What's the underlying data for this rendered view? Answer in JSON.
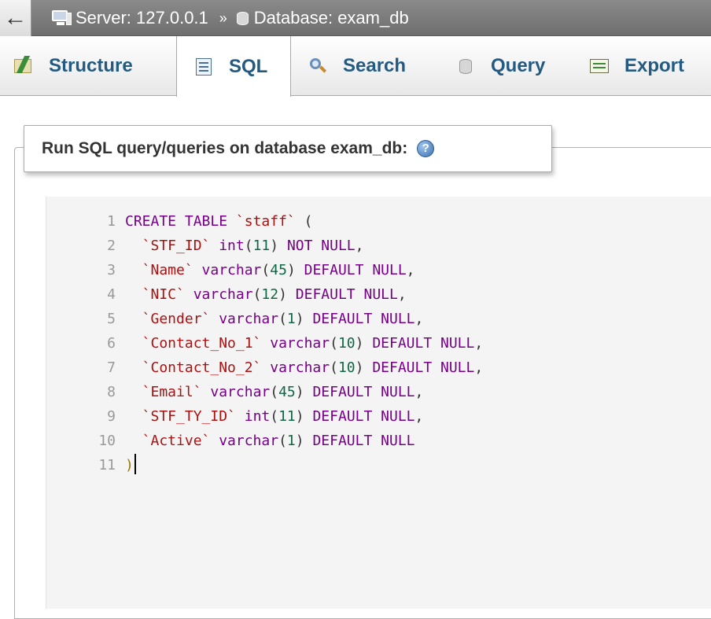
{
  "breadcrumb": {
    "back_label": "←",
    "server_label": "Server: 127.0.0.1",
    "separator": "»",
    "database_label": "Database: exam_db"
  },
  "tabs": [
    {
      "label": "Structure",
      "icon": "structure-icon",
      "active": false
    },
    {
      "label": "SQL",
      "icon": "sql-icon",
      "active": true
    },
    {
      "label": "Search",
      "icon": "search-icon",
      "active": false
    },
    {
      "label": "Query",
      "icon": "query-icon",
      "active": false
    },
    {
      "label": "Export",
      "icon": "export-icon",
      "active": false
    }
  ],
  "query_panel": {
    "legend": "Run SQL query/queries on database exam_db:",
    "help_icon": "help-icon"
  },
  "editor": {
    "line_numbers": [
      "1",
      "2",
      "3",
      "4",
      "5",
      "6",
      "7",
      "8",
      "9",
      "10",
      "11"
    ],
    "lines": [
      [
        {
          "t": "CREATE TABLE ",
          "c": "kw"
        },
        {
          "t": "`staff`",
          "c": "str"
        },
        {
          "t": " (",
          "c": "punc"
        }
      ],
      [
        {
          "t": "  `STF_ID`",
          "c": "str"
        },
        {
          "t": " int",
          "c": "kw"
        },
        {
          "t": "(",
          "c": "punc"
        },
        {
          "t": "11",
          "c": "num"
        },
        {
          "t": ") ",
          "c": "punc"
        },
        {
          "t": "NOT NULL",
          "c": "kw"
        },
        {
          "t": ",",
          "c": "punc"
        }
      ],
      [
        {
          "t": "  `Name`",
          "c": "str"
        },
        {
          "t": " varchar",
          "c": "kw"
        },
        {
          "t": "(",
          "c": "punc"
        },
        {
          "t": "45",
          "c": "num"
        },
        {
          "t": ") ",
          "c": "punc"
        },
        {
          "t": "DEFAULT NULL",
          "c": "kw"
        },
        {
          "t": ",",
          "c": "punc"
        }
      ],
      [
        {
          "t": "  `NIC`",
          "c": "str"
        },
        {
          "t": " varchar",
          "c": "kw"
        },
        {
          "t": "(",
          "c": "punc"
        },
        {
          "t": "12",
          "c": "num"
        },
        {
          "t": ") ",
          "c": "punc"
        },
        {
          "t": "DEFAULT NULL",
          "c": "kw"
        },
        {
          "t": ",",
          "c": "punc"
        }
      ],
      [
        {
          "t": "  `Gender`",
          "c": "str"
        },
        {
          "t": " varchar",
          "c": "kw"
        },
        {
          "t": "(",
          "c": "punc"
        },
        {
          "t": "1",
          "c": "num"
        },
        {
          "t": ") ",
          "c": "punc"
        },
        {
          "t": "DEFAULT NULL",
          "c": "kw"
        },
        {
          "t": ",",
          "c": "punc"
        }
      ],
      [
        {
          "t": "  `Contact_No_1`",
          "c": "str"
        },
        {
          "t": " varchar",
          "c": "kw"
        },
        {
          "t": "(",
          "c": "punc"
        },
        {
          "t": "10",
          "c": "num"
        },
        {
          "t": ") ",
          "c": "punc"
        },
        {
          "t": "DEFAULT NULL",
          "c": "kw"
        },
        {
          "t": ",",
          "c": "punc"
        }
      ],
      [
        {
          "t": "  `Contact_No_2`",
          "c": "str"
        },
        {
          "t": " varchar",
          "c": "kw"
        },
        {
          "t": "(",
          "c": "punc"
        },
        {
          "t": "10",
          "c": "num"
        },
        {
          "t": ") ",
          "c": "punc"
        },
        {
          "t": "DEFAULT NULL",
          "c": "kw"
        },
        {
          "t": ",",
          "c": "punc"
        }
      ],
      [
        {
          "t": "  `Email`",
          "c": "str"
        },
        {
          "t": " varchar",
          "c": "kw"
        },
        {
          "t": "(",
          "c": "punc"
        },
        {
          "t": "45",
          "c": "num"
        },
        {
          "t": ") ",
          "c": "punc"
        },
        {
          "t": "DEFAULT NULL",
          "c": "kw"
        },
        {
          "t": ",",
          "c": "punc"
        }
      ],
      [
        {
          "t": "  `STF_TY_ID`",
          "c": "str"
        },
        {
          "t": " int",
          "c": "kw"
        },
        {
          "t": "(",
          "c": "punc"
        },
        {
          "t": "11",
          "c": "num"
        },
        {
          "t": ") ",
          "c": "punc"
        },
        {
          "t": "DEFAULT NULL",
          "c": "kw"
        },
        {
          "t": ",",
          "c": "punc"
        }
      ],
      [
        {
          "t": "  `Active`",
          "c": "str"
        },
        {
          "t": " varchar",
          "c": "kw"
        },
        {
          "t": "(",
          "c": "punc"
        },
        {
          "t": "1",
          "c": "num"
        },
        {
          "t": ") ",
          "c": "punc"
        },
        {
          "t": "DEFAULT NULL",
          "c": "kw"
        }
      ],
      [
        {
          "t": ")",
          "c": "bracket"
        }
      ]
    ]
  }
}
